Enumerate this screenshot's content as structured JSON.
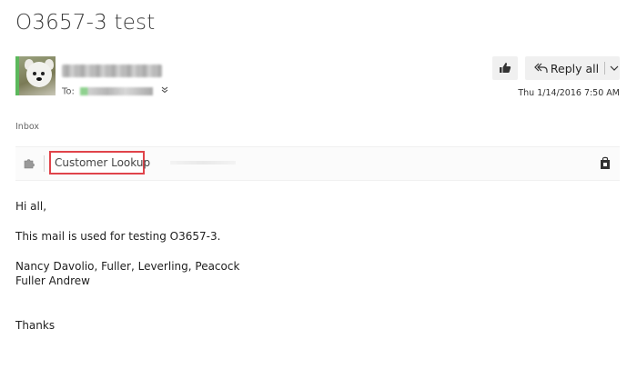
{
  "email": {
    "subject": "O3657-3 test",
    "to_label": "To:",
    "date": "Thu 1/14/2016 7:50 AM",
    "folder": "Inbox"
  },
  "actions": {
    "like_icon": "thumbs-up-icon",
    "reply_all_label": "Reply all",
    "reply_icon": "reply-all-icon",
    "more_icon": "chevron-down-icon"
  },
  "addin_bar": {
    "addin_icon": "puzzle-icon",
    "link_label": "Customer Lookup",
    "store_icon": "store-bag-icon",
    "highlight_color": "#e0434a"
  },
  "body": {
    "greeting": "Hi all,",
    "line1": "This mail is used for testing O3657-3.",
    "line2": "Nancy Davolio, Fuller, Leverling, Peacock",
    "line3": "Fuller Andrew",
    "closing": "Thanks"
  },
  "colors": {
    "presence": "#5cb85c",
    "button_bg": "#f0f0f0"
  }
}
